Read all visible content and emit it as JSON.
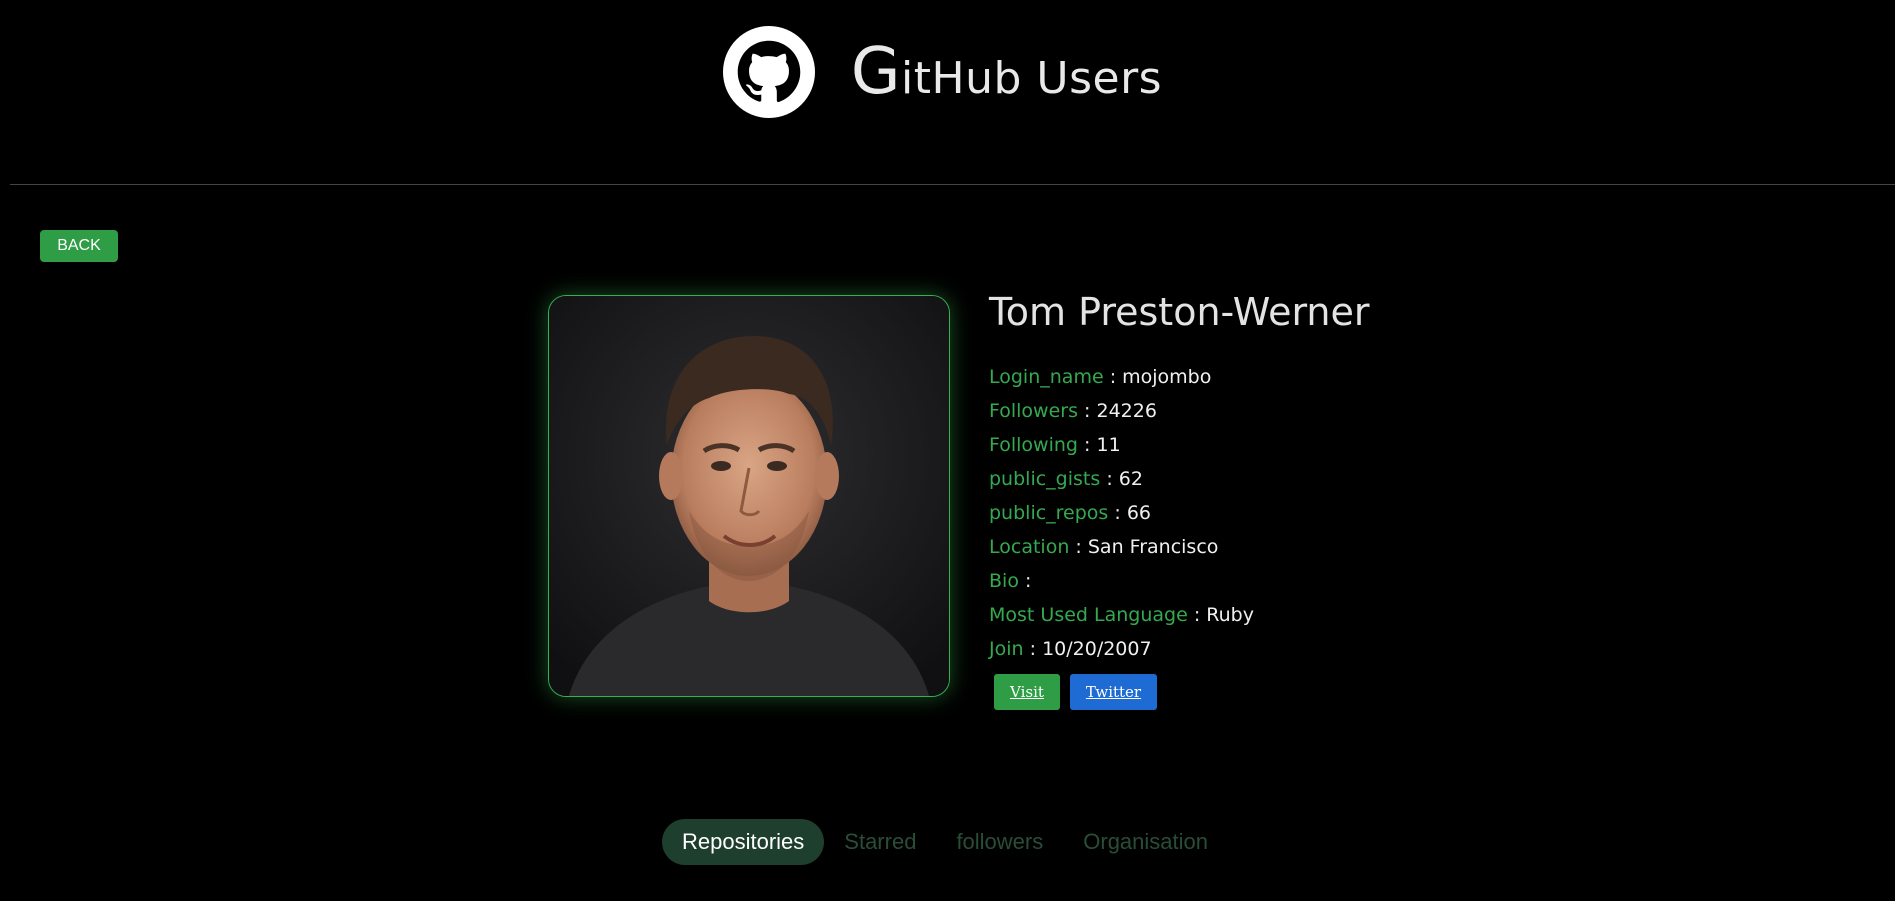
{
  "header": {
    "title_first_letter": "G",
    "title_rest": "itHub Users",
    "logo_icon": "github-octocat-icon"
  },
  "back_button": {
    "label": "BACK"
  },
  "profile": {
    "name": "Tom Preston-Werner",
    "fields": [
      {
        "key": "Login_name",
        "value": "mojombo"
      },
      {
        "key": "Followers",
        "value": "24226"
      },
      {
        "key": "Following",
        "value": "11"
      },
      {
        "key": "public_gists",
        "value": "62"
      },
      {
        "key": "public_repos",
        "value": "66"
      },
      {
        "key": "Location",
        "value": "San Francisco"
      },
      {
        "key": "Bio",
        "value": ""
      },
      {
        "key": "Most Used Language",
        "value": "Ruby"
      },
      {
        "key": "Join",
        "value": "10/20/2007"
      }
    ],
    "separator": ":",
    "visit_label": "Visit",
    "twitter_label": "Twitter"
  },
  "tabs": [
    {
      "label": "Repositories",
      "active": true
    },
    {
      "label": "Starred",
      "active": false
    },
    {
      "label": "followers",
      "active": false
    },
    {
      "label": "Organisation",
      "active": false
    }
  ],
  "colors": {
    "accent_green": "#35a94f",
    "button_green": "#2e9d45",
    "twitter_blue": "#1f6bd4",
    "background": "#000000"
  }
}
